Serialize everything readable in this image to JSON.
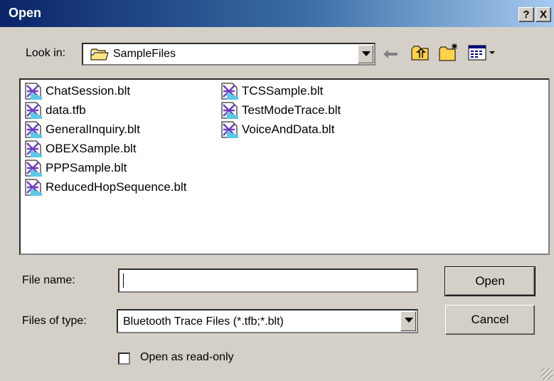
{
  "window": {
    "title": "Open",
    "help_label": "?",
    "close_label": "X"
  },
  "lookin": {
    "label": "Look in:",
    "value": "SampleFiles"
  },
  "toolbar": {
    "icons": [
      "back-arrow-icon",
      "up-folder-icon",
      "new-folder-icon",
      "view-menu-icon"
    ]
  },
  "files": [
    {
      "name": "ChatSession.blt"
    },
    {
      "name": "data.tfb"
    },
    {
      "name": "GeneralInquiry.blt"
    },
    {
      "name": "OBEXSample.blt"
    },
    {
      "name": "PPPSample.blt"
    },
    {
      "name": "ReducedHopSequence.blt"
    },
    {
      "name": "TCSSample.blt"
    },
    {
      "name": "TestModeTrace.blt"
    },
    {
      "name": "VoiceAndData.blt"
    }
  ],
  "filename": {
    "label": "File name:",
    "value": ""
  },
  "filetype": {
    "label": "Files of type:",
    "value": "Bluetooth Trace Files (*.tfb;*.blt)"
  },
  "buttons": {
    "open": "Open",
    "cancel": "Cancel"
  },
  "readonly": {
    "label": "Open as read-only",
    "checked": false
  },
  "colors": {
    "title_start": "#0a246a",
    "title_end": "#a6caf0",
    "face": "#d4d0c8"
  }
}
